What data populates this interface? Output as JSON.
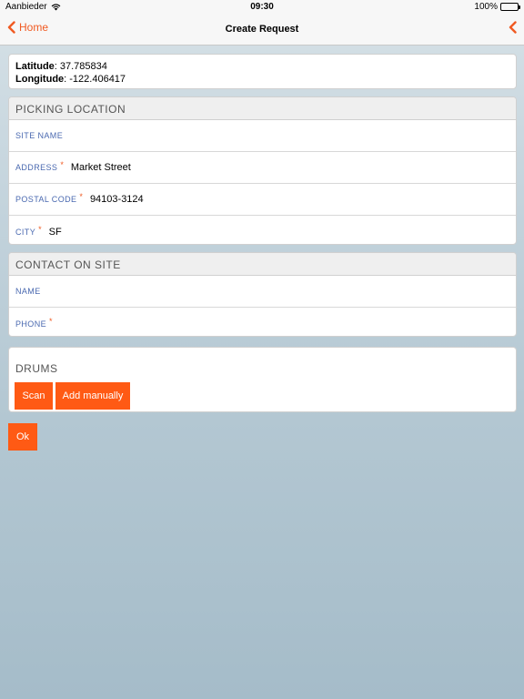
{
  "status_bar": {
    "carrier": "Aanbieder",
    "time": "09:30",
    "battery": "100%"
  },
  "nav": {
    "back_label": "Home",
    "title": "Create Request"
  },
  "location": {
    "latitude_label": "Latitude",
    "latitude_value": ": 37.785834",
    "longitude_label": "Longitude",
    "longitude_value": ": -122.406417"
  },
  "picking": {
    "header": "PICKING LOCATION",
    "site_name_label": "SITE NAME",
    "site_name_value": "",
    "address_label": "ADDRESS",
    "address_value": "Market Street",
    "postal_code_label": "POSTAL CODE",
    "postal_code_value": "94103-3124",
    "city_label": "CITY",
    "city_value": "SF",
    "required_mark": "*"
  },
  "contact": {
    "header": "CONTACT ON SITE",
    "name_label": "NAME",
    "name_value": "",
    "phone_label": "PHONE",
    "phone_value": ""
  },
  "drums": {
    "title": "DRUMS",
    "scan_label": "Scan",
    "add_manually_label": "Add manually"
  },
  "ok_label": "Ok",
  "colors": {
    "accent": "#f05a22",
    "button": "#ff5a14",
    "label": "#4a69b0"
  }
}
